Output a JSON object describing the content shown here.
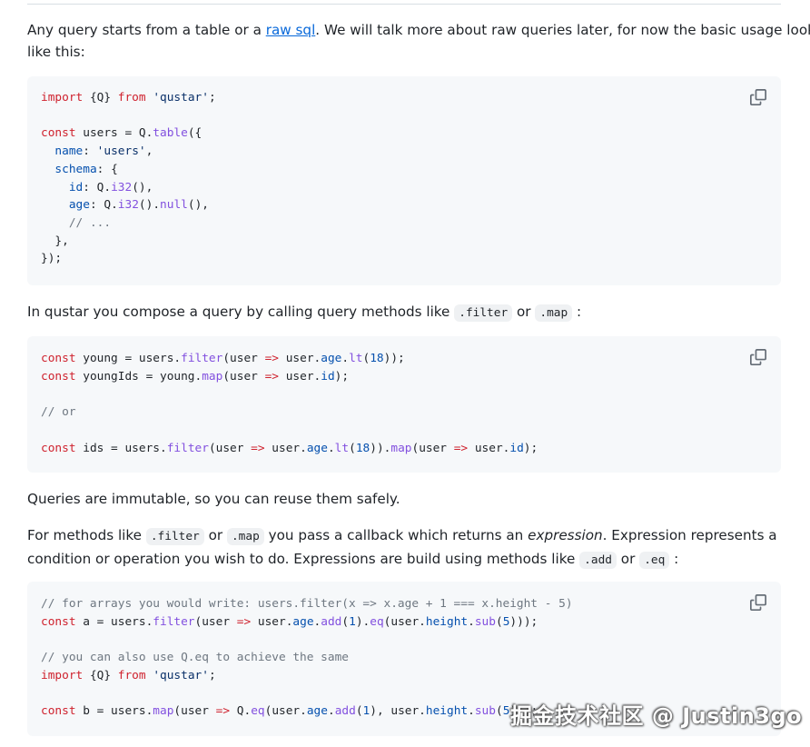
{
  "intro": {
    "before_link": "Any query starts from a table or a ",
    "link": "raw sql",
    "after_link": ". We will talk more about raw queries later, for now the basic usage looks",
    "line2": "like this:"
  },
  "code1": [
    "import {Q} from 'qustar';",
    "",
    "const users = Q.table({",
    "  name: 'users',",
    "  schema: {",
    "    id: Q.i32(),",
    "    age: Q.i32().null(),",
    "    // ...",
    "  },",
    "});"
  ],
  "compose": {
    "text": "In qustar you compose a query by calling query methods like ",
    "code1": ".filter",
    "or": " or ",
    "code2": ".map",
    "end": " :"
  },
  "code2": [
    "const young = users.filter(user => user.age.lt(18));",
    "const youngIds = young.map(user => user.id);",
    "",
    "// or",
    "",
    "const ids = users.filter(user => user.age.lt(18)).map(user => user.id);"
  ],
  "immutable": "Queries are immutable, so you can reuse them safely.",
  "methods": {
    "t1": "For methods like ",
    "c1": ".filter",
    "t2": " or ",
    "c2": ".map",
    "t3": " you pass a callback which returns an ",
    "em": "expression",
    "t4": ". Expression represents a",
    "t5": "condition or operation you wish to do. Expressions are build using methods like ",
    "c3": ".add",
    "t6": " or ",
    "c4": ".eq",
    "t7": " :"
  },
  "code3": [
    "// for arrays you would write: users.filter(x => x.age + 1 === x.height - 5)",
    "const a = users.filter(user => user.age.add(1).eq(user.height.sub(5)));",
    "",
    "// you can also use Q.eq to achieve the same",
    "import {Q} from 'qustar';",
    "",
    "const b = users.map(user => Q.eq(user.age.add(1), user.height.sub(5)));"
  ],
  "watermark": "掘金技术社区 @ Justin3go",
  "colors": {
    "keyword": "#cf222e",
    "string": "#0a3069",
    "function": "#8250df",
    "property": "#0550ae",
    "comment": "#6e7781",
    "link": "#0969da"
  },
  "icons": {
    "copy": "copy-icon"
  }
}
